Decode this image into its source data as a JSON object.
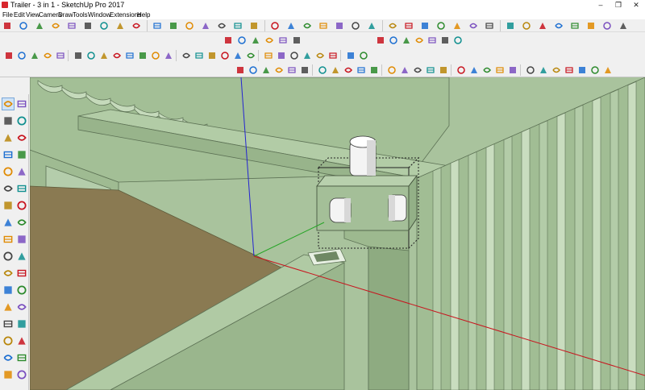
{
  "window": {
    "title": "Trailer - 3 in 1 - SketchUp Pro 2017",
    "minimize_glyph": "–",
    "maximize_glyph": "❐",
    "close_glyph": "✕"
  },
  "menu": {
    "items": [
      "File",
      "Edit",
      "View",
      "Camera",
      "Draw",
      "Tools",
      "Window",
      "Extensions",
      "Help"
    ]
  },
  "colors": {
    "model_green": "#a7c29a",
    "ground_brown": "#8a7a52",
    "axis_red": "#c8141e",
    "axis_green": "#27a527",
    "axis_blue": "#2424d2",
    "selection": "#222222"
  },
  "toolbars": {
    "row1_icons": [
      "follow-me-icon",
      "arc-icon",
      "pie-icon",
      "three-point-arc-icon",
      "circle-icon",
      "polygon-icon",
      "freehand-icon",
      "offset-icon",
      "scale-icon",
      "rotate-icon",
      "move-icon",
      "pushpull-icon",
      "tape-icon",
      "protractor-icon",
      "text-icon",
      "dimension-icon",
      "axes-icon",
      "section-icon",
      "paint-icon",
      "eraser-icon",
      "select-icon",
      "zoom-icon",
      "zoom-window-icon",
      "zoom-extents-icon",
      "orbit-icon",
      "pan-icon",
      "walk-icon",
      "look-around-icon",
      "position-camera-icon",
      "previous-view-icon",
      "next-view-icon",
      "plugin-a-icon",
      "plugin-b-icon",
      "plugin-c-icon",
      "plugin-d-icon",
      "plugin-e-icon",
      "plugin-f-icon",
      "plugin-g-icon"
    ],
    "views_icons": [
      "iso-view-icon",
      "top-view-icon",
      "front-view-icon",
      "right-view-icon",
      "back-view-icon",
      "left-view-icon"
    ],
    "styles_icons": [
      "xray-icon",
      "back-edges-icon",
      "wireframe-icon",
      "hidden-line-icon",
      "shaded-icon",
      "shaded-textures-icon",
      "monochrome-icon"
    ],
    "row3_icons": [
      "model-info-icon",
      "outliner-icon",
      "component-icon",
      "material-icon",
      "scenes-icon",
      "shadows-icon",
      "fog-icon",
      "layers-icon",
      "solid-union-icon",
      "solid-subtract-icon",
      "solid-trim-icon",
      "solid-intersect-icon",
      "solid-split-icon",
      "solid-outer-shell-icon",
      "sandbox-icon",
      "smoove-icon",
      "stamp-icon",
      "drape-icon",
      "add-detail-icon",
      "flip-edge-icon",
      "warehouse-icon",
      "extension-warehouse-icon",
      "share-model-icon",
      "layout-icon",
      "geo-location-icon",
      "photo-texture-icon",
      "settings-icon"
    ],
    "row4_icons": [
      "select-small-icon",
      "measure-icon",
      "front-axis-icon",
      "blue-axis-icon",
      "red-axis-icon",
      "green-axis-icon",
      "lock-icon",
      "unlock-icon",
      "hide-icon",
      "unhide-icon",
      "group-icon",
      "explode-icon",
      "make-component-icon",
      "intersect-faces-icon",
      "reverse-faces-icon",
      "orient-faces-icon",
      "soften-icon",
      "weld-icon",
      "purge-icon",
      "reload-icon",
      "export-icon",
      "import-icon",
      "print-icon",
      "undo-icon",
      "redo-icon",
      "help-icon",
      "warning-icon",
      "info-icon"
    ]
  },
  "left_tools": [
    "select-tool-icon",
    "make-component-tool-icon",
    "paint-bucket-tool-icon",
    "eraser-tool-icon",
    "line-tool-icon",
    "freehand-tool-icon",
    "rectangle-tool-icon",
    "rotated-rectangle-tool-icon",
    "circle-tool-icon",
    "polygon-tool-icon",
    "arc-tool-icon",
    "pie-tool-icon",
    "rotate-tool-icon",
    "move-tool-icon",
    "push-pull-tool-icon",
    "follow-me-tool-icon",
    "scale-tool-icon",
    "offset-tool-icon",
    "tape-measure-tool-icon",
    "dimension-tool-icon",
    "protractor-tool-icon",
    "text-tool-icon",
    "axes-tool-icon",
    "3d-text-tool-icon",
    "orbit-tool-icon",
    "pan-tool-icon",
    "zoom-tool-icon",
    "zoom-extents-tool-icon",
    "position-camera-tool-icon",
    "look-around-tool-icon",
    "walk-tool-icon",
    "section-plane-tool-icon",
    "footprints-tool-icon",
    "eye-tool-icon"
  ]
}
